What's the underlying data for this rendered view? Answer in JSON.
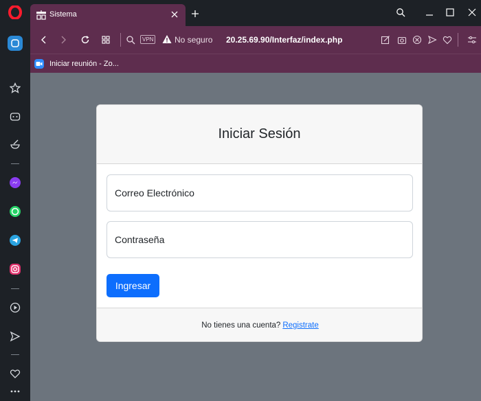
{
  "browser": {
    "tab": {
      "title": "Sistema"
    },
    "address": {
      "vpn_label": "VPN",
      "security_text": "No seguro",
      "url": "20.25.69.90/Interfaz/index.php"
    },
    "bookmarks": [
      {
        "label": "Iniciar reunión - Zo..."
      }
    ],
    "accent": "#5e2d4e"
  },
  "login": {
    "title": "Iniciar Sesión",
    "email_placeholder": "Correo Electrónico",
    "email_value": "",
    "password_placeholder": "Contraseña",
    "password_value": "",
    "submit_label": "Ingresar",
    "footer_text": "No tienes una cuenta?",
    "register_link": "Registrate",
    "button_color": "#0d6efd"
  }
}
